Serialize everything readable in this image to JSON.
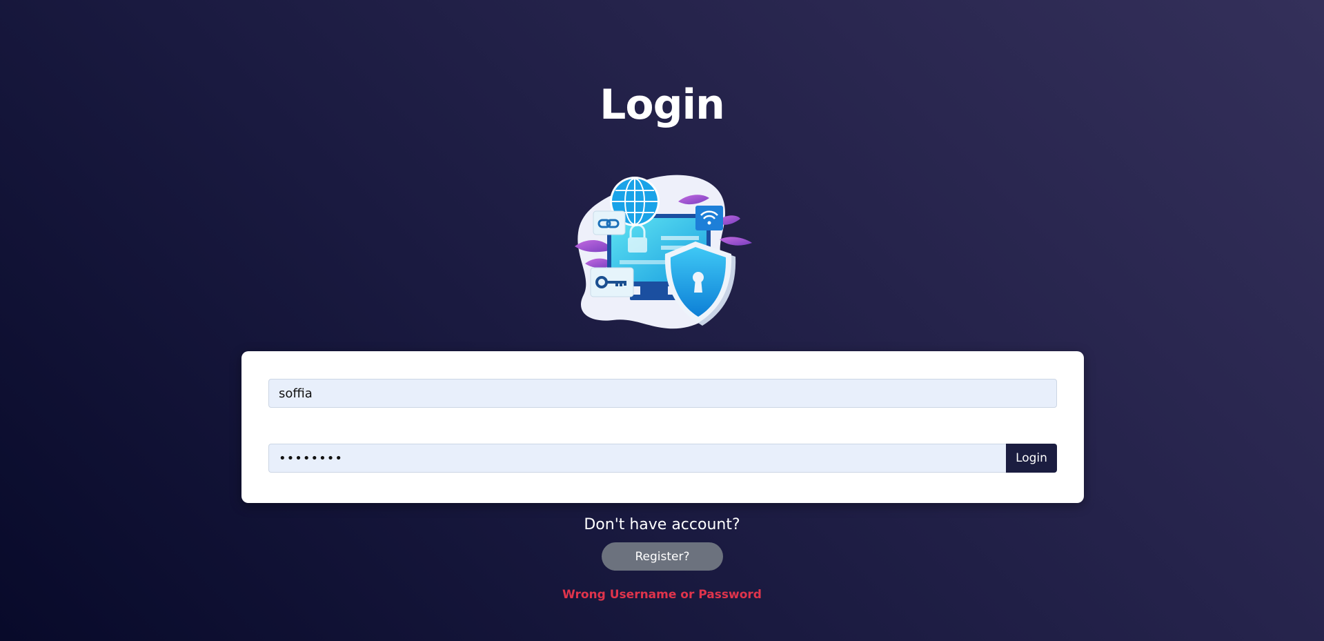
{
  "page": {
    "title": "Login"
  },
  "form": {
    "username_value": "soffia",
    "password_value": "soffia12",
    "login_label": "Login"
  },
  "register": {
    "prompt": "Don't have account?",
    "button_label": "Register?"
  },
  "error": {
    "message": "Wrong Username or Password"
  },
  "colors": {
    "background": "#1a1a40",
    "card": "#ffffff",
    "input_bg": "#e8effb",
    "login_button": "#1b1d40",
    "register_button": "#6c727e",
    "error": "#e0344c"
  },
  "illustration": {
    "icons": [
      "globe-icon",
      "link-icon",
      "wifi-icon",
      "monitor-icon",
      "padlock-icon",
      "shield-icon",
      "key-icon",
      "leaf-icon"
    ]
  }
}
